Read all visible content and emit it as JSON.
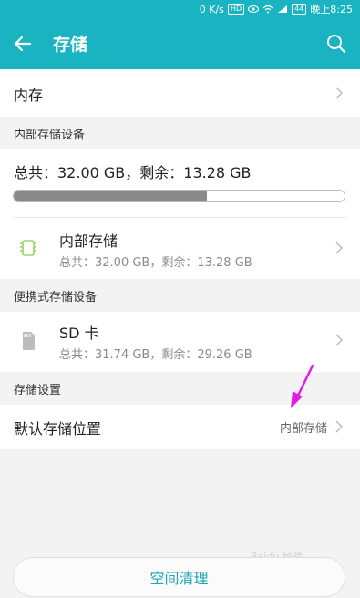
{
  "status_bar": {
    "net_speed": "0 K/s",
    "hd": "HD",
    "battery": "44",
    "time": "晚上8:25"
  },
  "app_bar": {
    "title": "存储"
  },
  "memory": {
    "label": "内存"
  },
  "internal_section": {
    "header": "内部存储设备",
    "summary": "总共：32.00 GB，剩余：13.28 GB",
    "usage_fraction": 0.585,
    "item": {
      "title": "内部存储",
      "detail": "总共：32.00 GB，剩余：13.28 GB"
    }
  },
  "portable_section": {
    "header": "便携式存储设备",
    "item": {
      "title": "SD 卡",
      "detail": "总共：31.74 GB，剩余：29.26 GB"
    }
  },
  "settings_section": {
    "header": "存储设置",
    "default_location": {
      "label": "默认存储位置",
      "value": "内部存储"
    }
  },
  "bottom_button": {
    "label": "空间清理"
  },
  "watermark": {
    "text": "Baidu 经验"
  },
  "colors": {
    "accent": "#1ab3c2",
    "button_text": "#1aa7b6",
    "pointer": "#e020e0"
  }
}
